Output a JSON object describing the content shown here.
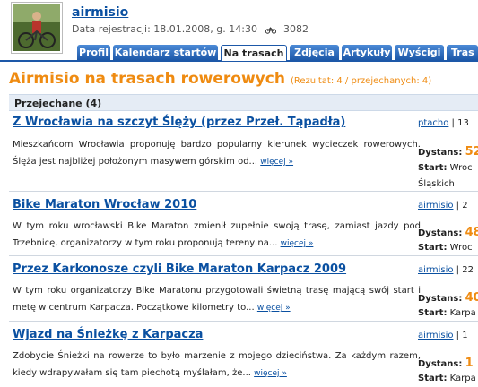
{
  "profile": {
    "username": "airmisio",
    "registration": "Data rejestracji: 18.01.2008, g. 14:30",
    "distance_total": "3082"
  },
  "tabs": [
    {
      "label": "Profil",
      "active": false
    },
    {
      "label": "Kalendarz startów",
      "active": false
    },
    {
      "label": "Na trasach",
      "active": true
    },
    {
      "label": "Zdjęcia",
      "active": false
    },
    {
      "label": "Artykuły",
      "active": false
    },
    {
      "label": "Wyścigi",
      "active": false
    },
    {
      "label": "Tras",
      "active": false
    }
  ],
  "page": {
    "title": "Airmisio na trasach rowerowych",
    "results": "(Rezultat: 4 / przejechanych: 4)",
    "section": "Przejechane (4)"
  },
  "routes": [
    {
      "title": "Z Wrocławia na szczyt Ślęży (przez Przeł. Tąpadła)",
      "desc": "Mieszkańcom Wrocławia proponuję bardzo popularny kierunek wycieczek rowerowych. Ślęża jest najbliżej położonym masywem górskim od...",
      "more": "więcej »",
      "author": "ptacho",
      "author_extra": "| 13",
      "dist_label": "Dystans:",
      "dist_value": "52",
      "start_label": "Start:",
      "start_value": "Wroc",
      "extra": "Śląskich"
    },
    {
      "title": "Bike Maraton Wrocław 2010",
      "desc": "W tym roku wrocławski Bike Maraton zmienił zupełnie swoją trasę, zamiast jazdy pod Trzebnicę, organizatorzy w tym roku proponują tereny na...",
      "more": "więcej »",
      "author": "airmisio",
      "author_extra": "| 2",
      "dist_label": "Dystans:",
      "dist_value": "48",
      "start_label": "Start:",
      "start_value": "Wroc",
      "extra": ""
    },
    {
      "title": "Przez Karkonosze czyli Bike Maraton Karpacz 2009",
      "desc": "W tym roku organizatorzy Bike Maratonu przygotowali świetną trasę mającą swój start i metę w centrum Karpacza. Początkowe kilometry to...",
      "more": "więcej »",
      "author": "airmisio",
      "author_extra": "| 22",
      "dist_label": "Dystans:",
      "dist_value": "40",
      "start_label": "Start:",
      "start_value": "Karpa",
      "extra": ""
    },
    {
      "title": "Wjazd na Śnieżkę z Karpacza",
      "desc": "Zdobycie Śnieżki na rowerze to było marzenie z mojego dzieciństwa. Za każdym razem, kiedy wdrapywałam się tam piechotą myślałam, że...",
      "more": "więcej »",
      "author": "airmisio",
      "author_extra": "| 1",
      "dist_label": "Dystans:",
      "dist_value": "1",
      "start_label": "Start:",
      "start_value": "Karpa",
      "extra": ""
    }
  ],
  "colors": {
    "link": "#0a50a1",
    "accent": "#ef8b11",
    "tab": "#1d58a8"
  }
}
